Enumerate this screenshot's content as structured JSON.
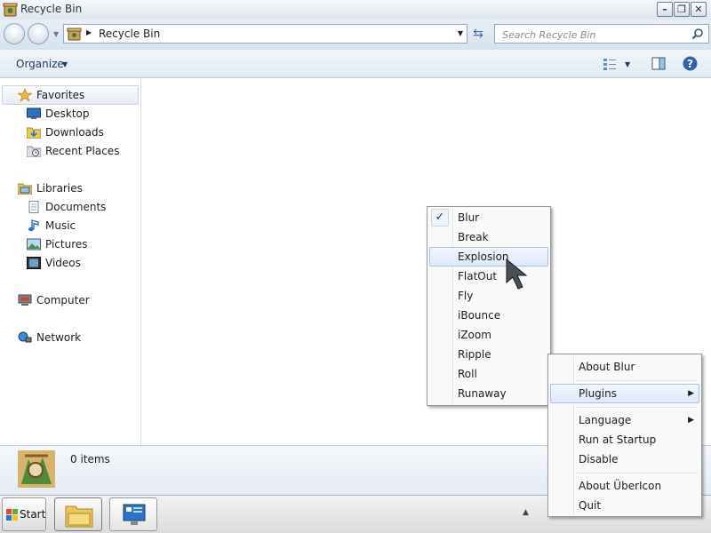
{
  "window": {
    "title": "Recycle Bin"
  },
  "address": {
    "crumb": "Recycle Bin"
  },
  "search": {
    "placeholder": "Search Recycle Bin"
  },
  "toolbar": {
    "organize_label": "Organize"
  },
  "nav": {
    "favorites": {
      "label": "Favorites",
      "items": [
        "Desktop",
        "Downloads",
        "Recent Places"
      ]
    },
    "libraries": {
      "label": "Libraries",
      "items": [
        "Documents",
        "Music",
        "Pictures",
        "Videos"
      ]
    },
    "computer": "Computer",
    "network": "Network"
  },
  "details": {
    "count": "0 items"
  },
  "taskbar": {
    "start_label": "Start"
  },
  "plugins_menu": {
    "items": [
      "Blur",
      "Break",
      "Explosion",
      "FlatOut",
      "Fly",
      "iBounce",
      "iZoom",
      "Ripple",
      "Roll",
      "Runaway"
    ],
    "checked": "Blur",
    "highlighted": "Explosion"
  },
  "context_menu": {
    "items": [
      "About Blur",
      "Plugins",
      "Language",
      "Run at Startup",
      "Disable",
      "About ÜberIcon",
      "Quit"
    ],
    "highlighted": "Plugins"
  },
  "colors": {
    "accent": "#3a6ea5",
    "menu_highlight_border": "#a7c1e5",
    "chrome": "#dfe6ef"
  }
}
